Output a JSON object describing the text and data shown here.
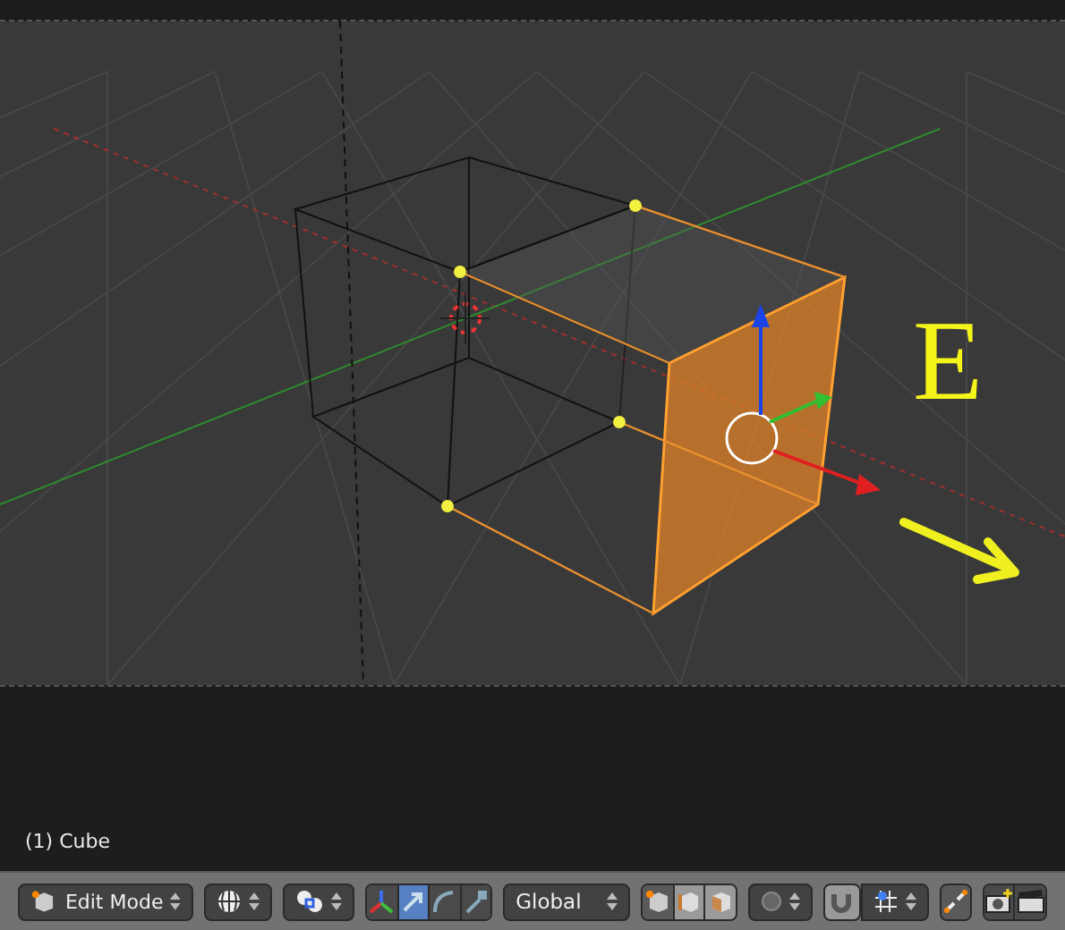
{
  "viewport": {
    "object_label": "(1) Cube",
    "annotation": "E"
  },
  "toolbar": {
    "mode": "Edit Mode",
    "manipulators": [
      {
        "kind": "axes",
        "selected": false
      },
      {
        "kind": "translate",
        "selected": true
      },
      {
        "kind": "rotate",
        "selected": false
      },
      {
        "kind": "scale",
        "selected": false
      }
    ],
    "orientation": "Global",
    "select_modes": [
      {
        "kind": "vertex",
        "selected": true
      },
      {
        "kind": "edge",
        "selected": false
      },
      {
        "kind": "face",
        "selected": false
      }
    ],
    "snap_on": false
  }
}
